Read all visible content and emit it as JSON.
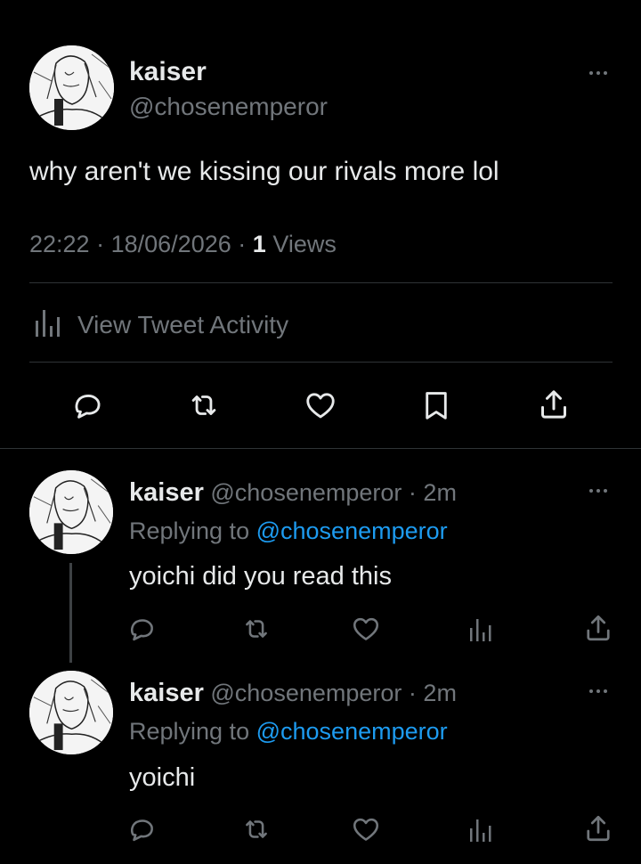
{
  "main_tweet": {
    "display_name": "kaiser",
    "handle": "@chosenemperor",
    "text": "why aren't we kissing our rivals more lol",
    "time": "22:22",
    "date": "18/06/2026",
    "separator": "·",
    "views_count": "1",
    "views_label": "Views",
    "activity_label": "View Tweet Activity"
  },
  "replies": [
    {
      "display_name": "kaiser",
      "handle": "@chosenemperor",
      "sep": "·",
      "age": "2m",
      "replying_prefix": "Replying to",
      "replying_to": "@chosenemperor",
      "text": "yoichi did you read this"
    },
    {
      "display_name": "kaiser",
      "handle": "@chosenemperor",
      "sep": "·",
      "age": "2m",
      "replying_prefix": "Replying to",
      "replying_to": "@chosenemperor",
      "text": "yoichi"
    }
  ],
  "colors": {
    "background": "#000000",
    "text": "#e7e9ea",
    "secondary": "#71767b",
    "link": "#1d9bf0",
    "divider": "#2f3336"
  },
  "icons": {
    "actions": [
      "reply-icon",
      "retweet-icon",
      "like-icon",
      "bookmark-icon",
      "share-icon"
    ],
    "reply_actions": [
      "reply-icon",
      "retweet-icon",
      "like-icon",
      "analytics-icon",
      "share-icon"
    ]
  }
}
